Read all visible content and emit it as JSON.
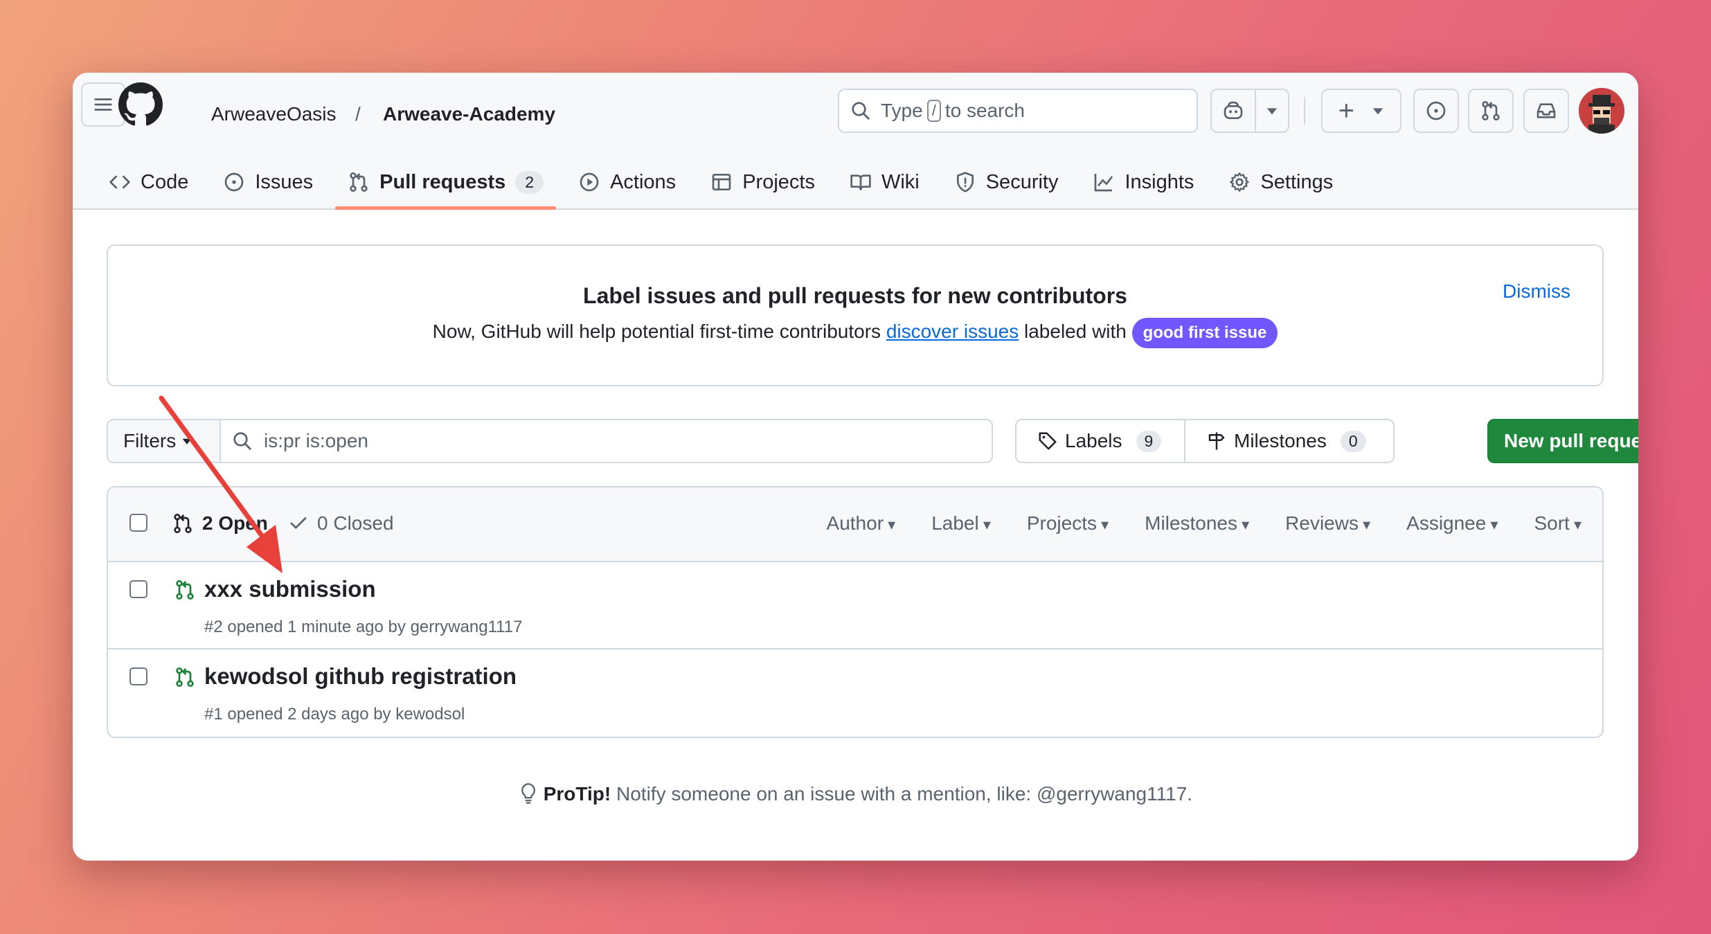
{
  "nav": {
    "owner": "ArweaveOasis",
    "separator": "/",
    "repo": "Arweave-Academy",
    "search_pre": "Type",
    "search_key": "/",
    "search_post": "to search",
    "plus": "+"
  },
  "tabs": [
    {
      "label": "Code",
      "icon": "code-icon"
    },
    {
      "label": "Issues",
      "icon": "issue-icon"
    },
    {
      "label": "Pull requests",
      "icon": "pull-request-icon",
      "count": "2",
      "active": true
    },
    {
      "label": "Actions",
      "icon": "play-icon"
    },
    {
      "label": "Projects",
      "icon": "table-icon"
    },
    {
      "label": "Wiki",
      "icon": "book-icon"
    },
    {
      "label": "Security",
      "icon": "shield-icon"
    },
    {
      "label": "Insights",
      "icon": "graph-icon"
    },
    {
      "label": "Settings",
      "icon": "gear-icon"
    }
  ],
  "banner": {
    "title": "Label issues and pull requests for new contributors",
    "text_pre": "Now, GitHub will help potential first-time contributors",
    "link": "discover issues",
    "text_post": "labeled with",
    "badge": "good first issue",
    "dismiss": "Dismiss"
  },
  "toolbar": {
    "filters": "Filters",
    "query": "is:pr is:open",
    "labels": "Labels",
    "labels_count": "9",
    "milestones": "Milestones",
    "milestones_count": "0",
    "new_pr": "New pull request"
  },
  "list": {
    "open": "2 Open",
    "closed": "0 Closed",
    "sorts": [
      "Author",
      "Label",
      "Projects",
      "Milestones",
      "Reviews",
      "Assignee",
      "Sort"
    ],
    "items": [
      {
        "title": "xxx submission",
        "meta": "#2 opened 1 minute ago by gerrywang1117"
      },
      {
        "title": "kewodsol github registration",
        "meta": "#1 opened 2 days ago by kewodsol"
      }
    ]
  },
  "protip": {
    "label": "ProTip!",
    "text": "Notify someone on an issue with a mention, like: @gerrywang1117."
  },
  "colors": {
    "accent_underline": "#fd8c73",
    "primary_button": "#1f883d",
    "link": "#0969da",
    "good_first_issue": "#7057ff",
    "annotation_arrow": "#e8403a",
    "open_pr_icon": "#1a7f37"
  }
}
